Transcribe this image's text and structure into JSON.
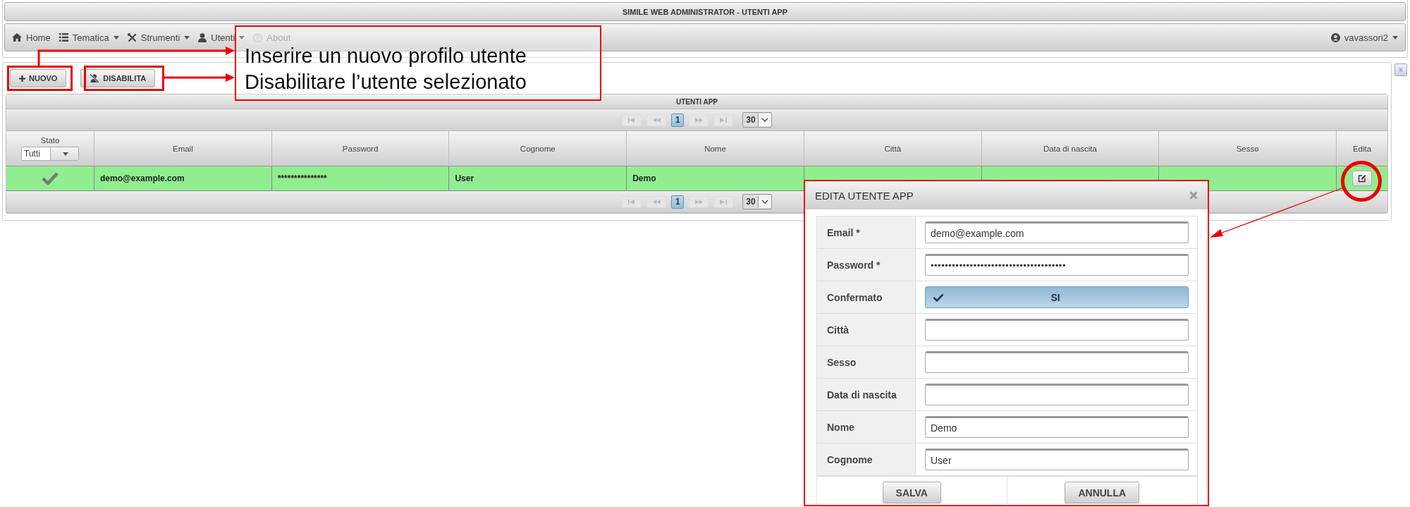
{
  "window": {
    "title": "SIMILE WEB ADMINISTRATOR - UTENTI APP"
  },
  "menu": {
    "items": [
      {
        "label": "Home",
        "dropdown": false,
        "disabled": false
      },
      {
        "label": "Tematica",
        "dropdown": true,
        "disabled": false
      },
      {
        "label": "Strumenti",
        "dropdown": true,
        "disabled": false
      },
      {
        "label": "Utenti",
        "dropdown": true,
        "disabled": false
      },
      {
        "label": "About",
        "dropdown": false,
        "disabled": true
      }
    ],
    "user": {
      "label": "vavassori2"
    }
  },
  "toolbar": {
    "buttons": [
      {
        "label": "NUOVO",
        "kind": "add"
      },
      {
        "label": "DISABILITA",
        "kind": "disable"
      }
    ]
  },
  "grid": {
    "title": "UTENTI APP",
    "pager_top": {
      "pages": [
        {
          "label": "1",
          "selected": true
        }
      ],
      "page_size": "30"
    },
    "columns": [
      "Stato",
      "Email",
      "Password",
      "Cognome",
      "Nome",
      "Città",
      "Data di nascita",
      "Sesso",
      "Edita"
    ],
    "status_filter": "Tutti",
    "rows": [
      {
        "selected": true,
        "confirmed": true,
        "cells": [
          "demo@example.com",
          "***************",
          "User",
          "Demo"
        ]
      }
    ],
    "pager_bottom": {
      "pages": [
        {
          "label": "1",
          "selected": true
        }
      ],
      "page_size": "30"
    }
  },
  "dialog": {
    "title": "EDITA UTENTE APP",
    "fields": [
      {
        "label": "Email *",
        "kind": "text",
        "value": "demo@example.com"
      },
      {
        "label": "Password *",
        "kind": "text",
        "value": "••••••••••••••••••••••••••••••••••••••"
      },
      {
        "label": "Confermato",
        "kind": "toggle",
        "on": true,
        "text": "SI"
      },
      {
        "label": "Città",
        "kind": "text"
      },
      {
        "label": "Sesso",
        "kind": "text"
      },
      {
        "label": "Data di nascita",
        "kind": "text"
      },
      {
        "label": "Nome",
        "kind": "text",
        "value": "Demo"
      },
      {
        "label": "Cognome",
        "kind": "text",
        "value": "User"
      }
    ],
    "buttons": [
      "SALVA",
      "ANNULLA"
    ]
  },
  "annotations": {
    "callout_lines": [
      "Inserire un nuovo profilo utente",
      "Disabilitare l’utente selezionato"
    ]
  }
}
